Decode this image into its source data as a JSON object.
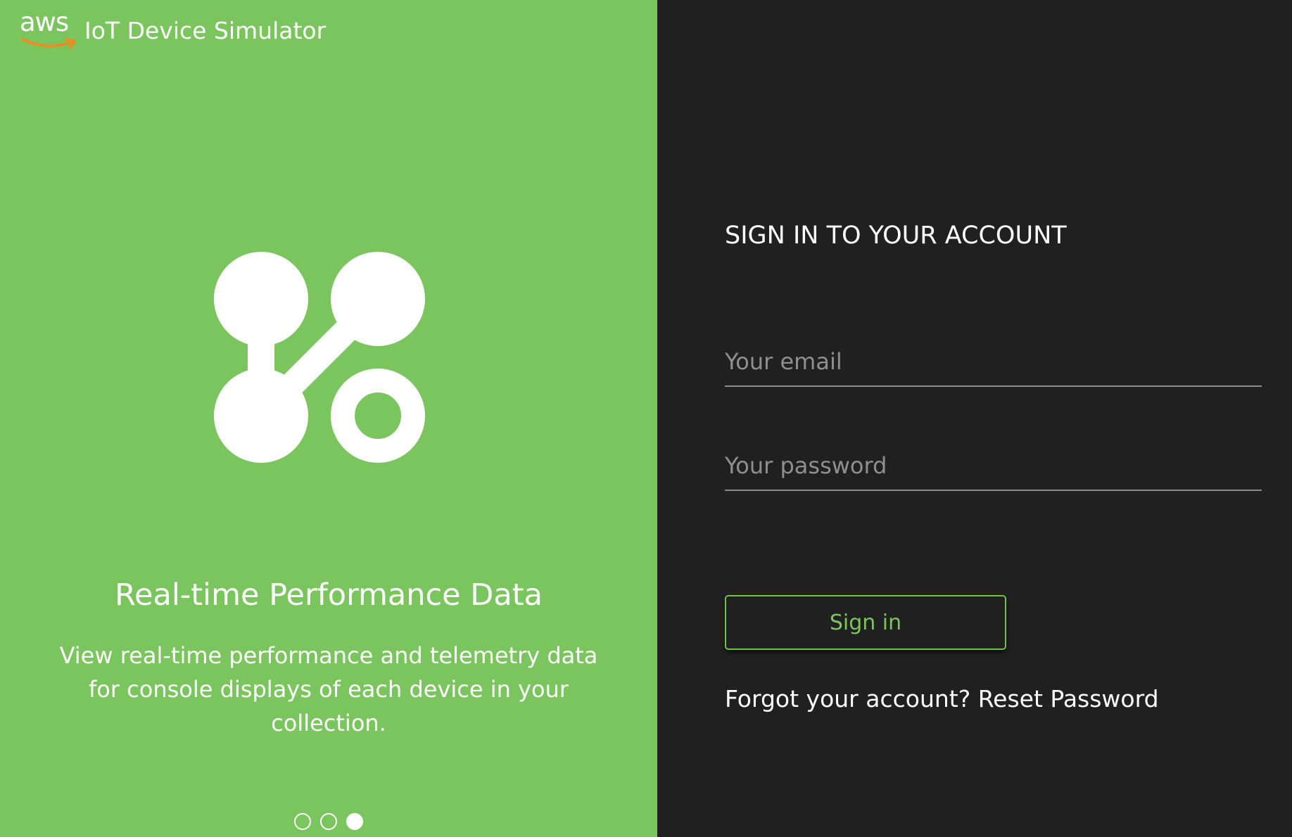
{
  "header": {
    "logo_text": "aws",
    "app_title": "IoT Device Simulator"
  },
  "carousel": {
    "slide_title": "Real-time Performance Data",
    "slide_description": "View real-time performance and telemetry data for console displays of each device in your collection.",
    "dots": [
      {
        "active": false
      },
      {
        "active": false
      },
      {
        "active": true
      }
    ],
    "active_index": 3,
    "total": 3,
    "icon": "device-network-icon"
  },
  "form": {
    "heading": "SIGN IN TO YOUR ACCOUNT",
    "email_placeholder": "Your email",
    "email_value": "",
    "password_placeholder": "Your password",
    "password_value": "",
    "signin_label": "Sign in",
    "forgot_text": "Forgot your account?",
    "reset_link_label": "Reset Password"
  },
  "colors": {
    "left_panel": "#7bc55f",
    "right_panel": "#202020",
    "accent": "#6ec24e",
    "aws_smile": "#f28b1f"
  }
}
